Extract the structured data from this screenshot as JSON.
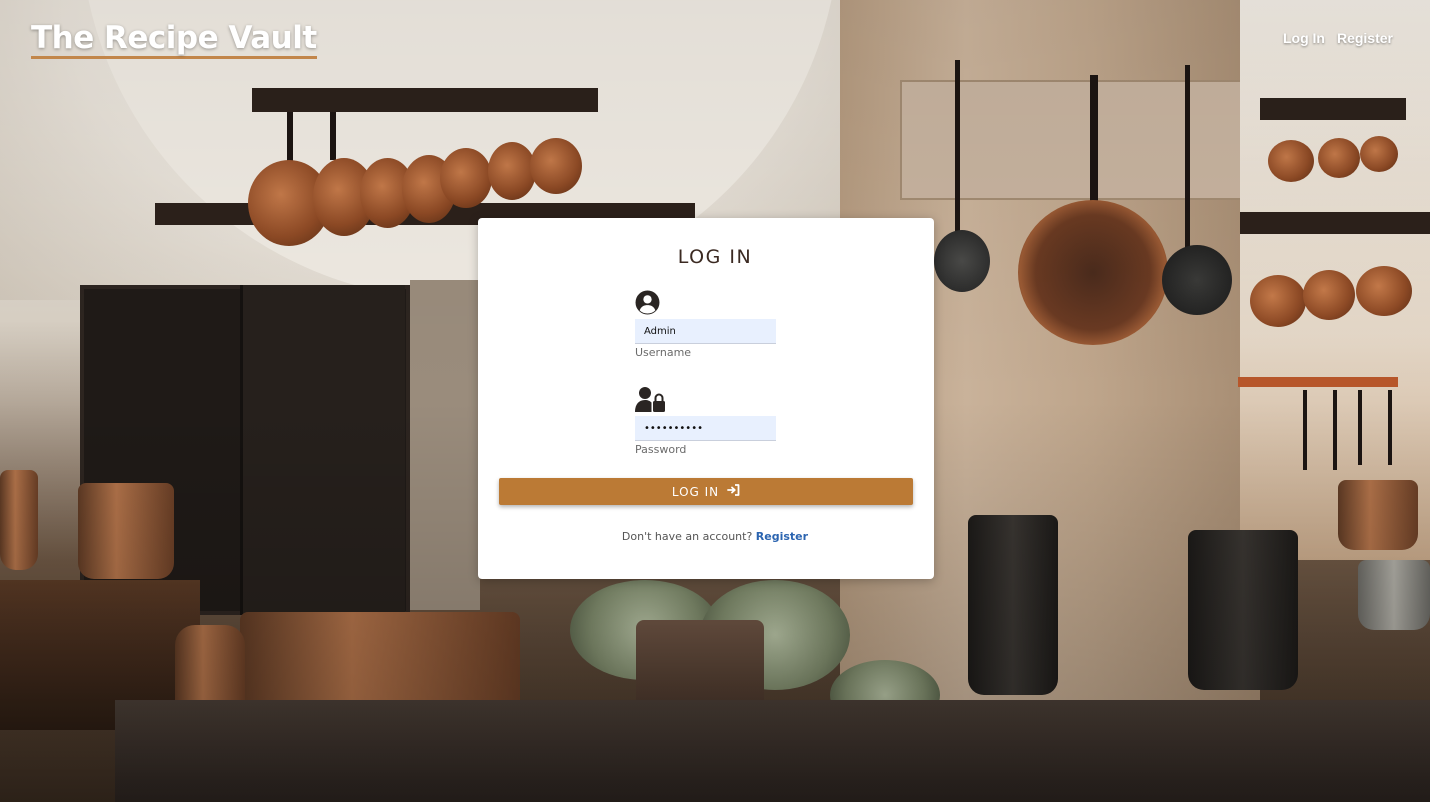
{
  "header": {
    "brand": "The Recipe Vault",
    "nav": {
      "login": "Log In",
      "register": "Register"
    }
  },
  "login_card": {
    "title": "LOG IN",
    "username": {
      "value": "Admin",
      "label": "Username",
      "icon": "user-circle-icon"
    },
    "password": {
      "value": "••••••••••",
      "label": "Password",
      "icon": "user-lock-icon"
    },
    "submit_label": "LOG IN",
    "submit_icon": "sign-in-icon",
    "footer_prompt": "Don't have an account?",
    "footer_link": "Register"
  },
  "colors": {
    "accent": "#bb7a35",
    "link": "#2b64b0",
    "input_bg": "#e8f0fe"
  }
}
